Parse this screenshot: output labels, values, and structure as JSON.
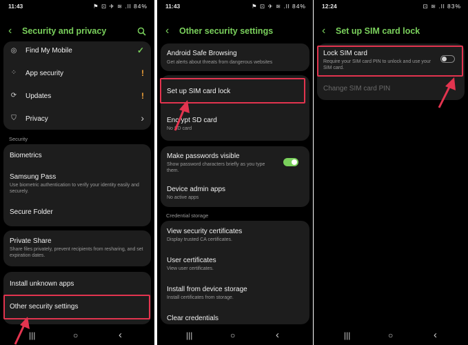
{
  "panel1": {
    "time": "11:43",
    "status_icons": "⚑ ⊡  ✈ ≋ .ll 84%",
    "title": "Security and privacy",
    "items_top": [
      {
        "label": "Find My Mobile",
        "icon": "location-icon"
      },
      {
        "label": "App security",
        "icon": "apps-icon"
      },
      {
        "label": "Updates",
        "icon": "update-icon"
      },
      {
        "label": "Privacy",
        "icon": "shield-icon"
      }
    ],
    "security_header": "Security",
    "biometrics": "Biometrics",
    "samsung_pass": {
      "label": "Samsung Pass",
      "desc": "Use biometric authentication to verify your identity easily and securely."
    },
    "secure_folder": "Secure Folder",
    "private_share": {
      "label": "Private Share",
      "desc": "Share files privately, prevent recipients from resharing, and set expiration dates."
    },
    "install_unknown": "Install unknown apps",
    "other_security": "Other security settings",
    "colors": {
      "accent": "#7ad05c",
      "warning": "#f2a23a",
      "highlight": "#e3344f"
    }
  },
  "panel2": {
    "time": "11:43",
    "status_icons": "⚑ ⊡  ✈ ≋ .ll 84%",
    "title": "Other security settings",
    "safe_browsing": {
      "label": "Android Safe Browsing",
      "desc": "Get alerts about threats from dangerous websites"
    },
    "sim_lock": "Set up SIM card lock",
    "encrypt_sd": {
      "label": "Encrypt SD card",
      "desc": "No SD card"
    },
    "passwords_visible": {
      "label": "Make passwords visible",
      "desc": "Show password characters briefly as you type them.",
      "enabled": true
    },
    "device_admin": {
      "label": "Device admin apps",
      "desc": "No active apps"
    },
    "credential_header": "Credential storage",
    "view_certs": {
      "label": "View security certificates",
      "desc": "Display trusted CA certificates."
    },
    "user_certs": {
      "label": "User certificates",
      "desc": "View user certificates."
    },
    "install_storage": {
      "label": "Install from device storage",
      "desc": "Install certificates from storage."
    },
    "clear_credentials": "Clear credentials"
  },
  "panel3": {
    "time": "12:24",
    "status_icons": "⊡  ≋ .ll 83%",
    "title": "Set up SIM card lock",
    "lock_sim": {
      "label": "Lock SIM card",
      "desc": "Require your SIM card PIN to unlock and use your SIM card.",
      "enabled": false
    },
    "change_pin": "Change SIM card PIN"
  },
  "navbar": {
    "recents": "|||",
    "home": "○",
    "back": "‹"
  }
}
